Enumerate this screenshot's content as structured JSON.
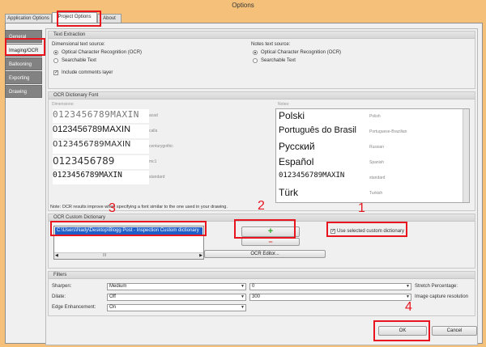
{
  "window": {
    "title": "Options"
  },
  "top_tabs": [
    {
      "label": "Application Options"
    },
    {
      "label": "Project Options"
    },
    {
      "label": "About"
    }
  ],
  "side_tabs": [
    {
      "label": "General"
    },
    {
      "label": "Imaging/OCR"
    },
    {
      "label": "Ballooning"
    },
    {
      "label": "Exporting"
    },
    {
      "label": "Drawing"
    }
  ],
  "text_extraction": {
    "header": "Text Extraction",
    "dimensional_label": "Dimensional text source:",
    "dimensional_options": [
      "Optical Character Recognition (OCR)",
      "Searchable Text"
    ],
    "notes_label": "Notes text source:",
    "notes_options": [
      "Optical Character Recognition (OCR)",
      "Searchable Text"
    ],
    "include_comments_label": "Include comments layer"
  },
  "ocr_font": {
    "header": "OCR Dictionary Font",
    "dimensions_label": "Dimensions:",
    "notes_label": "Notes:",
    "dimension_fonts": [
      {
        "sample": "0123456789MAXIN",
        "name": "acad"
      },
      {
        "sample": "0123456789MAXIN",
        "name": "calla"
      },
      {
        "sample": "0123456789MAXIN",
        "name": "centurygothic"
      },
      {
        "sample": "0123456789",
        "name": "mc1"
      },
      {
        "sample": "0123456789MAXIN",
        "name": "standard"
      }
    ],
    "note_fonts": [
      {
        "sample": "Polski",
        "name": "Polish"
      },
      {
        "sample": "Português do Brasil",
        "name": "Portuguese-Brazilian"
      },
      {
        "sample": "Русский",
        "name": "Russian"
      },
      {
        "sample": "Español",
        "name": "Spanish"
      },
      {
        "sample": "0123456789MAXIN",
        "name": "standard"
      },
      {
        "sample": "Türk",
        "name": "Turkish"
      }
    ],
    "note": "Note:  OCR results improve when specifying a font similar to the one used in your drawing."
  },
  "custom_dictionary": {
    "header": "OCR Custom Dictionary",
    "selected_path": "C:\\Users\\Nady\\Desktop\\Blogg Post - Inspection Custom dictionary",
    "scroll_label": "III",
    "add_icon": "+",
    "remove_icon": "−",
    "editor_label": "OCR Editor...",
    "use_selected_label": "Use selected custom dictionary"
  },
  "filters": {
    "header": "Filters",
    "sharpen_label": "Sharpen:",
    "sharpen_value": "Medium",
    "dilate_label": "Dilate:",
    "dilate_value": "Off",
    "edge_label": "Edge Enhancement:",
    "edge_value": "On",
    "stretch_value": "0",
    "stretch_label": "Stretch Percentage:",
    "resolution_value": "300",
    "resolution_label": "Image capture resolution"
  },
  "buttons": {
    "ok": "OK",
    "cancel": "Cancel"
  },
  "annotations": [
    "1",
    "2",
    "3",
    "4"
  ],
  "colors": {
    "annotation": "#e8141e",
    "selection": "#1f5ec7",
    "plus": "#2fa82f",
    "minus": "#d43c3c"
  }
}
